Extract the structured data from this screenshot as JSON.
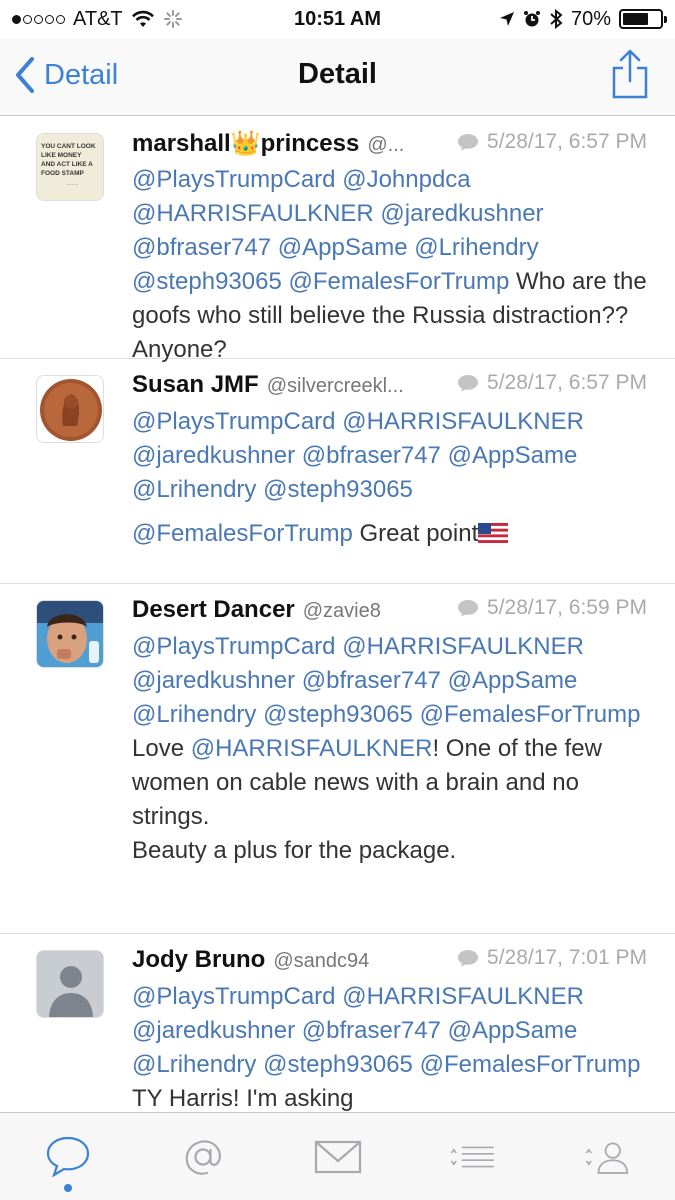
{
  "status_bar": {
    "carrier": "AT&T",
    "time": "10:51 AM",
    "battery": "70%",
    "battery_level": 0.7
  },
  "nav": {
    "back_label": "Detail",
    "title": "Detail"
  },
  "tweets": [
    {
      "name": "marshall👑princess",
      "handle": "@...",
      "time": "5/28/17, 6:57 PM",
      "avatar_text": "YOU CANT LOOK LIKE MONEY AND ACT LIKE A FOOD STAMP"
    },
    {
      "name": "Susan JMF",
      "handle": "@silvercreekl...",
      "time": "5/28/17, 6:57 PM"
    },
    {
      "name": "Desert Dancer",
      "handle": "@zavie8",
      "time": "5/28/17, 6:59 PM"
    },
    {
      "name": "Jody Bruno",
      "handle": "@sandc94",
      "time": "5/28/17, 7:01 PM"
    }
  ],
  "text": {
    "t1_m1": "@PlaysTrumpCard",
    "t1_m2": "@Johnpdca",
    "t1_m3": "@HARRISFAULKNER",
    "t1_m4": "@jaredkushner",
    "t1_m5": "@bfraser747",
    "t1_m6": "@AppSame",
    "t1_m7": "@Lrihendry",
    "t1_m8": "@steph93065",
    "t1_m9": "@FemalesForTrump",
    "t1_rest": " Who are the goofs who still believe the Russia distraction??  Anyone?",
    "t2_m1": "@PlaysTrumpCard",
    "t2_m2": "@HARRISFAULKNER",
    "t2_m3": "@jaredkushner",
    "t2_m4": "@bfraser747",
    "t2_m5": "@AppSame",
    "t2_m6": "@Lrihendry",
    "t2_m7": "@steph93065",
    "t2_m8": "@FemalesForTrump",
    "t2_rest": " Great point",
    "t3_m1": "@PlaysTrumpCard",
    "t3_m2": "@HARRISFAULKNER",
    "t3_m3": "@jaredkushner",
    "t3_m4": "@bfraser747",
    "t3_m5": "@AppSame",
    "t3_m6": "@Lrihendry",
    "t3_m7": "@steph93065",
    "t3_m8": "@FemalesForTrump",
    "t3_love": " Love ",
    "t3_m9": "@HARRISFAULKNER",
    "t3_rest": "! One of the few women on cable news with a brain and no strings.",
    "t3_line2": "Beauty a plus for the package.",
    "t4_m1": "@PlaysTrumpCard",
    "t4_m2": "@HARRISFAULKNER",
    "t4_m3": "@jaredkushner",
    "t4_m4": "@bfraser747",
    "t4_m5": "@AppSame",
    "t4_m6": "@Lrihendry",
    "t4_m7": "@steph93065",
    "t4_m8": "@FemalesForTrump",
    "t4_rest": " TY Harris! I'm asking"
  },
  "tabs": [
    {
      "icon": "speech-bubble-icon",
      "active": true
    },
    {
      "icon": "at-sign-icon",
      "active": false
    },
    {
      "icon": "envelope-icon",
      "active": false
    },
    {
      "icon": "list-icon",
      "active": false
    },
    {
      "icon": "person-icon",
      "active": false
    }
  ],
  "colors": {
    "accent": "#3b82d6",
    "mention": "#4a78b5",
    "timestamp": "#aaaaaa"
  }
}
